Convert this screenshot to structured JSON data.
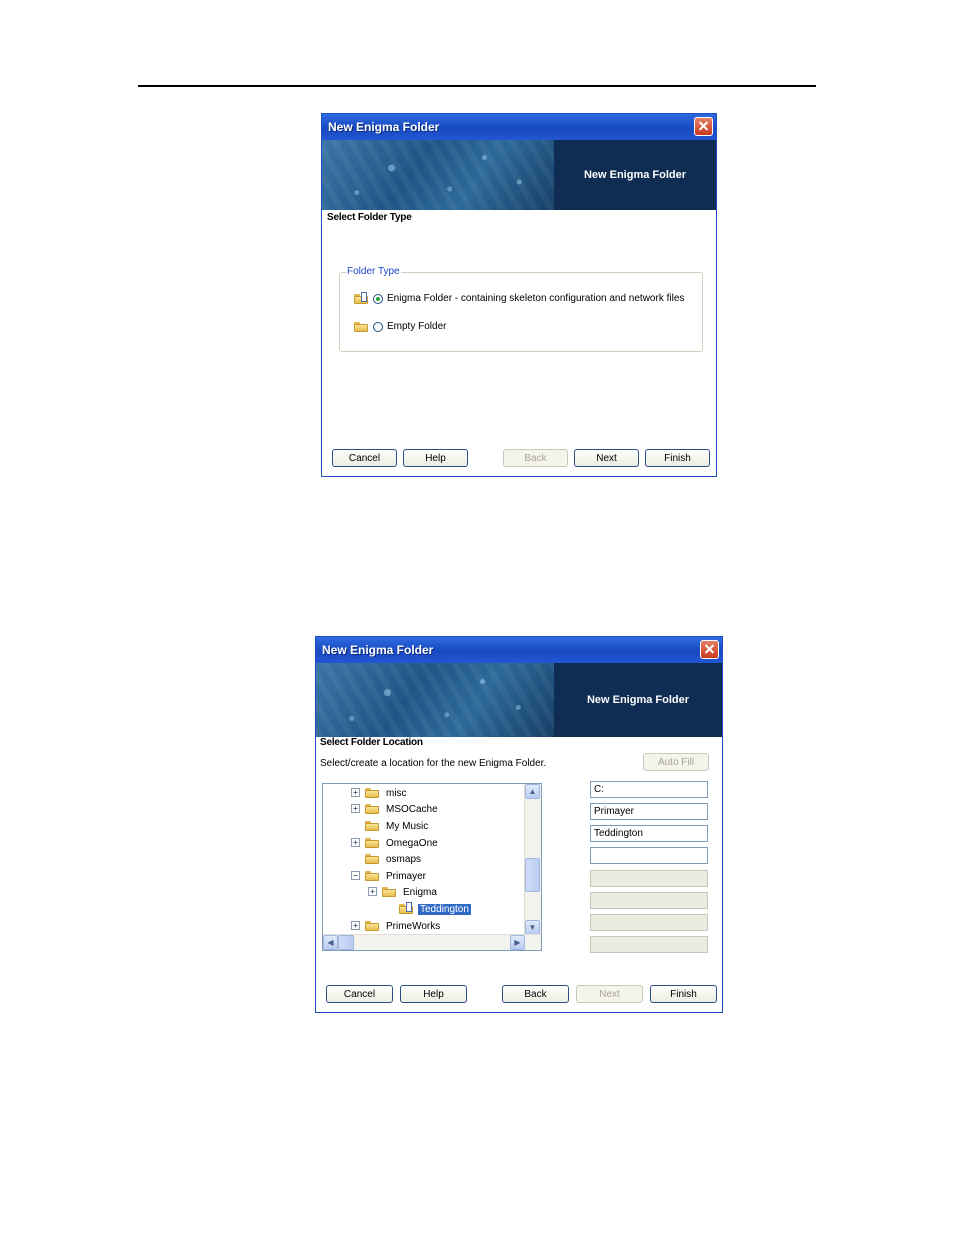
{
  "dialog1": {
    "title": "New Enigma Folder",
    "banner_text": "New Enigma Folder",
    "step_title": "Select Folder Type",
    "group_label": "Folder Type",
    "options": [
      {
        "label": "Enigma Folder - containing skeleton configuration and network files",
        "checked": true
      },
      {
        "label": "Empty Folder",
        "checked": false
      }
    ],
    "buttons": {
      "cancel": "Cancel",
      "help": "Help",
      "back": "Back",
      "next": "Next",
      "finish": "Finish"
    }
  },
  "dialog2": {
    "title": "New Enigma Folder",
    "banner_text": "New Enigma Folder",
    "step_title": "Select Folder Location",
    "instruction": "Select/create a location for the new Enigma Folder.",
    "auto_fill": "Auto Fill",
    "tree": [
      {
        "label": "misc"
      },
      {
        "label": "MSOCache"
      },
      {
        "label": "My Music"
      },
      {
        "label": "OmegaOne"
      },
      {
        "label": "osmaps"
      },
      {
        "label": "Primayer"
      },
      {
        "label": "Enigma"
      },
      {
        "label": "Teddington"
      },
      {
        "label": "PrimeWorks"
      }
    ],
    "path_fields": [
      "C:",
      "Primayer",
      "Teddington",
      "",
      "",
      "",
      "",
      ""
    ],
    "buttons": {
      "cancel": "Cancel",
      "help": "Help",
      "back": "Back",
      "next": "Next",
      "finish": "Finish"
    }
  }
}
